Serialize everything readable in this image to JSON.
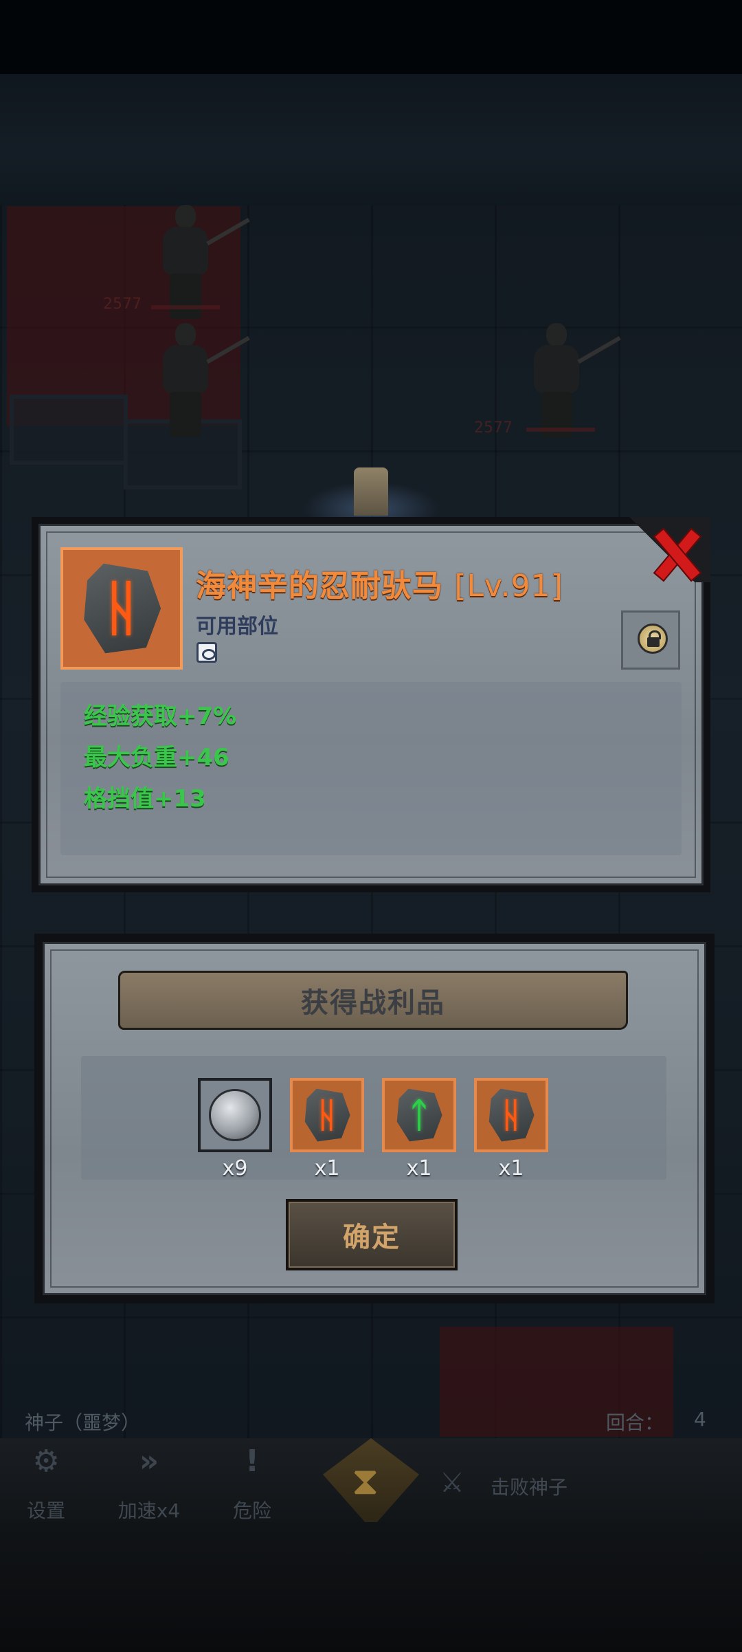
{
  "item": {
    "name": "海神辛的忍耐驮马",
    "level": "[Lv.91]",
    "slot_label": "可用部位",
    "stats": [
      "经验获取+7%",
      "最大负重+46",
      "格挡值+13"
    ]
  },
  "loot": {
    "title": "获得战利品",
    "items": [
      {
        "type": "coin-icon",
        "count": "x9"
      },
      {
        "type": "rune-orange-icon",
        "count": "x1"
      },
      {
        "type": "rune-green-icon",
        "count": "x1"
      },
      {
        "type": "rune-orange-icon",
        "count": "x1"
      }
    ],
    "confirm_label": "确定"
  },
  "background": {
    "damage_numbers": [
      "2577",
      "2577"
    ]
  },
  "hud": {
    "boss_name": "神子（噩梦）",
    "round_label": "回合：",
    "round_value": "4",
    "settings_label": "设置",
    "speed_label": "加速x4",
    "danger_label": "危险",
    "task_label": "击败神子"
  },
  "colors": {
    "item_name": "#f28a3c",
    "stat_green": "#39c64a",
    "close_red": "#d21a1a",
    "confirm_text": "#d2a46a"
  }
}
